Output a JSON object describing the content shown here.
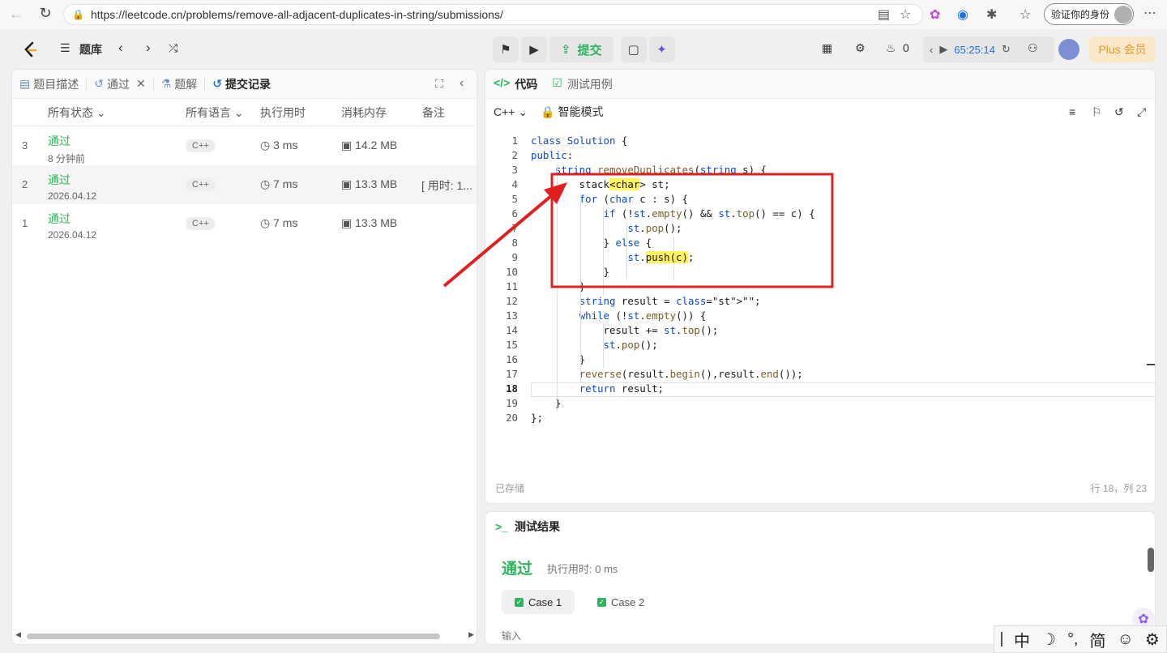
{
  "browser": {
    "url": "https://leetcode.cn/problems/remove-all-adjacent-duplicates-in-string/submissions/",
    "profile_label": "验证你的身份"
  },
  "topnav": {
    "problem_bank": "题库",
    "submit_label": "提交",
    "streak_count": "0",
    "timer": "65:25:14",
    "plus_label": "Plus 会员"
  },
  "left_tabs": [
    {
      "label": "题目描述",
      "icon": "doc-icon"
    },
    {
      "label": "通过",
      "icon": "history-icon"
    },
    {
      "label": "题解",
      "icon": "flask-icon"
    },
    {
      "label": "提交记录",
      "icon": "history-icon"
    }
  ],
  "table": {
    "headers": [
      "所有状态",
      "所有语言",
      "执行用时",
      "消耗内存",
      "备注"
    ],
    "rows": [
      {
        "index": "3",
        "status": "通过",
        "time_ago": "8 分钟前",
        "lang": "C++",
        "runtime": "3 ms",
        "memory": "14.2 MB",
        "note": ""
      },
      {
        "index": "2",
        "status": "通过",
        "time_ago": "2026.04.12",
        "lang": "C++",
        "runtime": "7 ms",
        "memory": "13.3 MB",
        "note": "[ 用时: 1..."
      },
      {
        "index": "1",
        "status": "通过",
        "time_ago": "2026.04.12",
        "lang": "C++",
        "runtime": "7 ms",
        "memory": "13.3 MB",
        "note": ""
      }
    ]
  },
  "editor": {
    "tab_code": "代码",
    "tab_tests": "测试用例",
    "language": "C++",
    "mode": "智能模式",
    "saved": "已存储",
    "cursor": "行 18，列 23"
  },
  "code_lines": [
    "class Solution {",
    "public:",
    "    string removeDuplicates(string s) {",
    "        stack<char> st;",
    "        for (char c : s) {",
    "            if (!st.empty() && st.top() == c) {",
    "                st.pop();",
    "            } else {",
    "                st.push(c);",
    "            }",
    "        }",
    "        string result = \"\";",
    "        while (!st.empty()) {",
    "            result += st.top();",
    "            st.pop();",
    "        }",
    "        reverse(result.begin(),result.end());",
    "        return result;",
    "    }",
    "};"
  ],
  "result": {
    "title": "测试结果",
    "status": "通过",
    "runtime": "执行用时: 0 ms",
    "cases": [
      "Case 1",
      "Case 2"
    ],
    "input_label": "输入"
  },
  "ime": [
    "中",
    "☽",
    "°,",
    "简",
    "☺",
    "⚙"
  ],
  "colors": {
    "accent_green": "#2db55d",
    "annotation_red": "#e02020",
    "highlight": "#fff25c"
  }
}
